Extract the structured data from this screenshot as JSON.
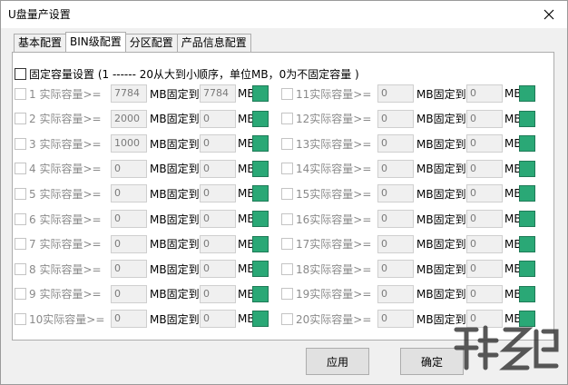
{
  "window": {
    "title": "U盘量产设置"
  },
  "tabs": [
    {
      "label": "基本配置",
      "active": false
    },
    {
      "label": "BIN级配置",
      "active": true
    },
    {
      "label": "分区配置",
      "active": false
    },
    {
      "label": "产品信息配置",
      "active": false
    }
  ],
  "fixed_capacity": {
    "label": "固定容量设置 (1 ------ 20从大到小顺序，单位MB，0为不固定容量 )"
  },
  "rows_left": [
    {
      "label": "1 实际容量>=",
      "value": "7784",
      "fixed_label": "MB固定到",
      "fixed_value": "7784",
      "unit": "MB"
    },
    {
      "label": "2 实际容量>=",
      "value": "2000",
      "fixed_label": "MB固定到",
      "fixed_value": "0",
      "unit": "MB"
    },
    {
      "label": "3 实际容量>=",
      "value": "1000",
      "fixed_label": "MB固定到",
      "fixed_value": "0",
      "unit": "MB"
    },
    {
      "label": "4 实际容量>=",
      "value": "0",
      "fixed_label": "MB固定到",
      "fixed_value": "0",
      "unit": "MB"
    },
    {
      "label": "5 实际容量>=",
      "value": "0",
      "fixed_label": "MB固定到",
      "fixed_value": "0",
      "unit": "MB"
    },
    {
      "label": "6 实际容量>=",
      "value": "0",
      "fixed_label": "MB固定到",
      "fixed_value": "0",
      "unit": "MB"
    },
    {
      "label": "7 实际容量>=",
      "value": "0",
      "fixed_label": "MB固定到",
      "fixed_value": "0",
      "unit": "MB"
    },
    {
      "label": "8 实际容量>=",
      "value": "0",
      "fixed_label": "MB固定到",
      "fixed_value": "0",
      "unit": "MB"
    },
    {
      "label": "9 实际容量>=",
      "value": "0",
      "fixed_label": "MB固定到",
      "fixed_value": "0",
      "unit": "MB"
    },
    {
      "label": "10实际容量>=",
      "value": "0",
      "fixed_label": "MB固定到",
      "fixed_value": "0",
      "unit": "MB"
    }
  ],
  "rows_right": [
    {
      "label": "11实际容量>=",
      "value": "0",
      "fixed_label": "MB固定到",
      "fixed_value": "0",
      "unit": "MB"
    },
    {
      "label": "12实际容量>=",
      "value": "0",
      "fixed_label": "MB固定到",
      "fixed_value": "0",
      "unit": "MB"
    },
    {
      "label": "13实际容量>=",
      "value": "0",
      "fixed_label": "MB固定到",
      "fixed_value": "0",
      "unit": "MB"
    },
    {
      "label": "14实际容量>=",
      "value": "0",
      "fixed_label": "MB固定到",
      "fixed_value": "0",
      "unit": "MB"
    },
    {
      "label": "15实际容量>=",
      "value": "0",
      "fixed_label": "MB固定到",
      "fixed_value": "0",
      "unit": "MB"
    },
    {
      "label": "16实际容量>=",
      "value": "0",
      "fixed_label": "MB固定到",
      "fixed_value": "0",
      "unit": "MB"
    },
    {
      "label": "17实际容量>=",
      "value": "0",
      "fixed_label": "MB固定到",
      "fixed_value": "0",
      "unit": "MB"
    },
    {
      "label": "18实际容量>=",
      "value": "0",
      "fixed_label": "MB固定到",
      "fixed_value": "0",
      "unit": "MB"
    },
    {
      "label": "19实际容量>=",
      "value": "0",
      "fixed_label": "MB固定到",
      "fixed_value": "0",
      "unit": "MB"
    },
    {
      "label": "20实际容量>=",
      "value": "0",
      "fixed_label": "MB固定到",
      "fixed_value": "0",
      "unit": "MB"
    }
  ],
  "colors": {
    "swatch": "#2aa876"
  },
  "buttons": {
    "apply": "应用",
    "ok": "确定"
  },
  "icons": {
    "close": "close-icon",
    "watermark": "watermark-logo"
  }
}
